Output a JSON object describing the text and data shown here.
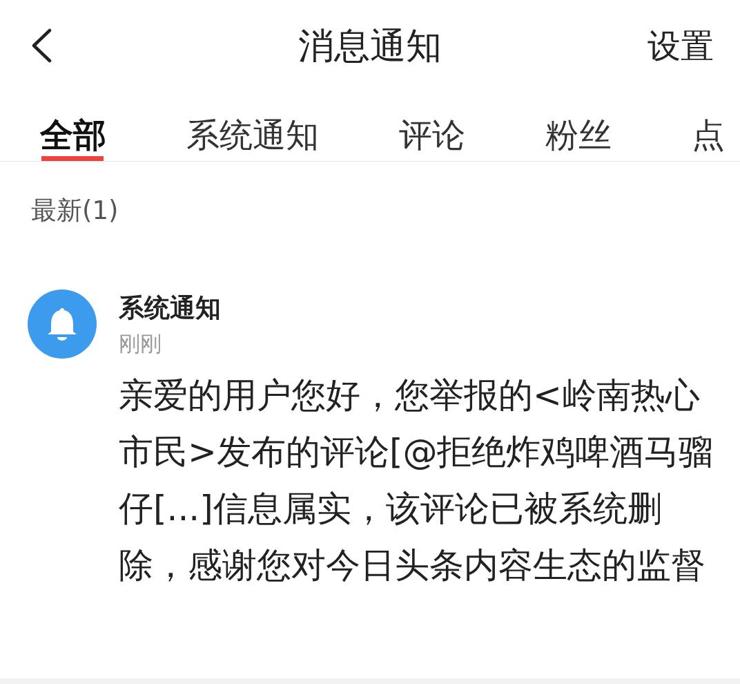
{
  "header": {
    "title": "消息通知",
    "action": "设置"
  },
  "tabs": [
    {
      "label": "全部",
      "selected": true
    },
    {
      "label": "系统通知",
      "selected": false
    },
    {
      "label": "评论",
      "selected": false
    },
    {
      "label": "粉丝",
      "selected": false
    },
    {
      "label": "点",
      "selected": false
    }
  ],
  "section": "最新(1)",
  "notifications": [
    {
      "sender": "系统通知",
      "time": "刚刚",
      "message": "亲爱的用户您好，您举报的<岭南热心市民>发布的评论[@拒绝炸鸡啤酒马骝仔[...]信息属实，该评论已被系统删除，感谢您对今日头条内容生态的监督",
      "color": "#3d9bee"
    }
  ]
}
